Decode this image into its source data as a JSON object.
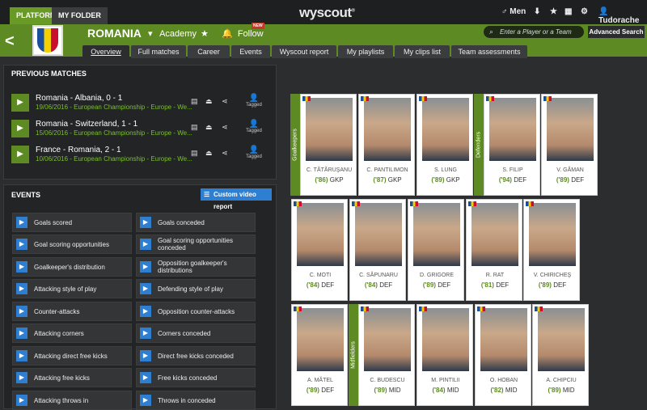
{
  "topbar": {
    "tabs": [
      "PLATFORM",
      "MY FOLDER"
    ],
    "logo": "wyscout",
    "gender": "Men",
    "user": "Tudorache"
  },
  "header": {
    "team": "ROMANIA",
    "academy": "Academy",
    "follow": "Follow",
    "new_badge": "NEW",
    "search_placeholder": "Enter a Player or a Team",
    "advanced_search": "Advanced Search"
  },
  "subtabs": [
    "Overview",
    "Full matches",
    "Career",
    "Events",
    "Wyscout report",
    "My playlists",
    "My clips list",
    "Team assessments"
  ],
  "previous_matches": {
    "title": "PREVIOUS MATCHES",
    "tagged_label": "Tagged",
    "matches": [
      {
        "title": "Romania - Albania, 0 - 1",
        "sub": "19/06/2016 - European Championship - Europe - We..."
      },
      {
        "title": "Romania - Switzerland, 1 - 1",
        "sub": "15/06/2016 - European Championship - Europe - We..."
      },
      {
        "title": "France - Romania, 2 - 1",
        "sub": "10/06/2016 - European Championship - Europe - We..."
      }
    ]
  },
  "events": {
    "title": "EVENTS",
    "custom_video_report": "Custom video report",
    "left": [
      "Goals scored",
      "Goal scoring opportunities",
      "Goalkeeper's distribution",
      "Attacking style of play",
      "Counter-attacks",
      "Attacking corners",
      "Attacking direct free kicks",
      "Attacking free kicks",
      "Attacking throws in"
    ],
    "right": [
      "Goals conceded",
      "Goal scoring opportunities conceded",
      "Opposition goalkeeper's distributions",
      "Defending style of play",
      "Opposition counter-attacks",
      "Corners conceded",
      "Direct free kicks conceded",
      "Free kicks conceded",
      "Throws in conceded"
    ]
  },
  "squad": {
    "groups": {
      "goalkeepers": "Goalkeepers",
      "defenders": "Defenders",
      "midfielders": "Midfielders"
    },
    "players": [
      {
        "name": "C. TĂTĂRUŞANU",
        "year": "('86)",
        "pos": "GKP"
      },
      {
        "name": "C. PANTILIMON",
        "year": "('87)",
        "pos": "GKP"
      },
      {
        "name": "S. LUNG",
        "year": "('89)",
        "pos": "GKP"
      },
      {
        "name": "S. FILIP",
        "year": "('94)",
        "pos": "DEF"
      },
      {
        "name": "V. GĂMAN",
        "year": "('89)",
        "pos": "DEF"
      },
      {
        "name": "C. MOTI",
        "year": "('84)",
        "pos": "DEF"
      },
      {
        "name": "C. SĂPUNARU",
        "year": "('84)",
        "pos": "DEF"
      },
      {
        "name": "D. GRIGORE",
        "year": "('89)",
        "pos": "DEF"
      },
      {
        "name": "R. RAT",
        "year": "('81)",
        "pos": "DEF"
      },
      {
        "name": "V. CHIRICHEŞ",
        "year": "('89)",
        "pos": "DEF"
      },
      {
        "name": "A. MĂTEL",
        "year": "('89)",
        "pos": "DEF"
      },
      {
        "name": "C. BUDESCU",
        "year": "('89)",
        "pos": "MID"
      },
      {
        "name": "M. PINTILII",
        "year": "('84)",
        "pos": "MID"
      },
      {
        "name": "O. HOBAN",
        "year": "('82)",
        "pos": "MID"
      },
      {
        "name": "A. CHIPCIU",
        "year": "('89)",
        "pos": "MID"
      }
    ]
  }
}
